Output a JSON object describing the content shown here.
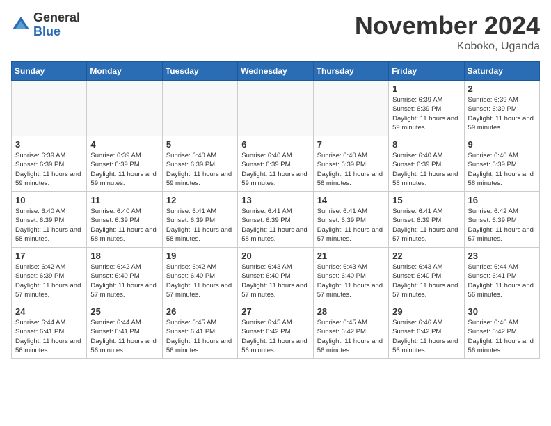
{
  "logo": {
    "general": "General",
    "blue": "Blue"
  },
  "title": "November 2024",
  "location": "Koboko, Uganda",
  "days_of_week": [
    "Sunday",
    "Monday",
    "Tuesday",
    "Wednesday",
    "Thursday",
    "Friday",
    "Saturday"
  ],
  "weeks": [
    [
      {
        "day": "",
        "info": ""
      },
      {
        "day": "",
        "info": ""
      },
      {
        "day": "",
        "info": ""
      },
      {
        "day": "",
        "info": ""
      },
      {
        "day": "",
        "info": ""
      },
      {
        "day": "1",
        "info": "Sunrise: 6:39 AM\nSunset: 6:39 PM\nDaylight: 11 hours and 59 minutes."
      },
      {
        "day": "2",
        "info": "Sunrise: 6:39 AM\nSunset: 6:39 PM\nDaylight: 11 hours and 59 minutes."
      }
    ],
    [
      {
        "day": "3",
        "info": "Sunrise: 6:39 AM\nSunset: 6:39 PM\nDaylight: 11 hours and 59 minutes."
      },
      {
        "day": "4",
        "info": "Sunrise: 6:39 AM\nSunset: 6:39 PM\nDaylight: 11 hours and 59 minutes."
      },
      {
        "day": "5",
        "info": "Sunrise: 6:40 AM\nSunset: 6:39 PM\nDaylight: 11 hours and 59 minutes."
      },
      {
        "day": "6",
        "info": "Sunrise: 6:40 AM\nSunset: 6:39 PM\nDaylight: 11 hours and 59 minutes."
      },
      {
        "day": "7",
        "info": "Sunrise: 6:40 AM\nSunset: 6:39 PM\nDaylight: 11 hours and 58 minutes."
      },
      {
        "day": "8",
        "info": "Sunrise: 6:40 AM\nSunset: 6:39 PM\nDaylight: 11 hours and 58 minutes."
      },
      {
        "day": "9",
        "info": "Sunrise: 6:40 AM\nSunset: 6:39 PM\nDaylight: 11 hours and 58 minutes."
      }
    ],
    [
      {
        "day": "10",
        "info": "Sunrise: 6:40 AM\nSunset: 6:39 PM\nDaylight: 11 hours and 58 minutes."
      },
      {
        "day": "11",
        "info": "Sunrise: 6:40 AM\nSunset: 6:39 PM\nDaylight: 11 hours and 58 minutes."
      },
      {
        "day": "12",
        "info": "Sunrise: 6:41 AM\nSunset: 6:39 PM\nDaylight: 11 hours and 58 minutes."
      },
      {
        "day": "13",
        "info": "Sunrise: 6:41 AM\nSunset: 6:39 PM\nDaylight: 11 hours and 58 minutes."
      },
      {
        "day": "14",
        "info": "Sunrise: 6:41 AM\nSunset: 6:39 PM\nDaylight: 11 hours and 57 minutes."
      },
      {
        "day": "15",
        "info": "Sunrise: 6:41 AM\nSunset: 6:39 PM\nDaylight: 11 hours and 57 minutes."
      },
      {
        "day": "16",
        "info": "Sunrise: 6:42 AM\nSunset: 6:39 PM\nDaylight: 11 hours and 57 minutes."
      }
    ],
    [
      {
        "day": "17",
        "info": "Sunrise: 6:42 AM\nSunset: 6:39 PM\nDaylight: 11 hours and 57 minutes."
      },
      {
        "day": "18",
        "info": "Sunrise: 6:42 AM\nSunset: 6:40 PM\nDaylight: 11 hours and 57 minutes."
      },
      {
        "day": "19",
        "info": "Sunrise: 6:42 AM\nSunset: 6:40 PM\nDaylight: 11 hours and 57 minutes."
      },
      {
        "day": "20",
        "info": "Sunrise: 6:43 AM\nSunset: 6:40 PM\nDaylight: 11 hours and 57 minutes."
      },
      {
        "day": "21",
        "info": "Sunrise: 6:43 AM\nSunset: 6:40 PM\nDaylight: 11 hours and 57 minutes."
      },
      {
        "day": "22",
        "info": "Sunrise: 6:43 AM\nSunset: 6:40 PM\nDaylight: 11 hours and 57 minutes."
      },
      {
        "day": "23",
        "info": "Sunrise: 6:44 AM\nSunset: 6:41 PM\nDaylight: 11 hours and 56 minutes."
      }
    ],
    [
      {
        "day": "24",
        "info": "Sunrise: 6:44 AM\nSunset: 6:41 PM\nDaylight: 11 hours and 56 minutes."
      },
      {
        "day": "25",
        "info": "Sunrise: 6:44 AM\nSunset: 6:41 PM\nDaylight: 11 hours and 56 minutes."
      },
      {
        "day": "26",
        "info": "Sunrise: 6:45 AM\nSunset: 6:41 PM\nDaylight: 11 hours and 56 minutes."
      },
      {
        "day": "27",
        "info": "Sunrise: 6:45 AM\nSunset: 6:42 PM\nDaylight: 11 hours and 56 minutes."
      },
      {
        "day": "28",
        "info": "Sunrise: 6:45 AM\nSunset: 6:42 PM\nDaylight: 11 hours and 56 minutes."
      },
      {
        "day": "29",
        "info": "Sunrise: 6:46 AM\nSunset: 6:42 PM\nDaylight: 11 hours and 56 minutes."
      },
      {
        "day": "30",
        "info": "Sunrise: 6:46 AM\nSunset: 6:42 PM\nDaylight: 11 hours and 56 minutes."
      }
    ]
  ]
}
